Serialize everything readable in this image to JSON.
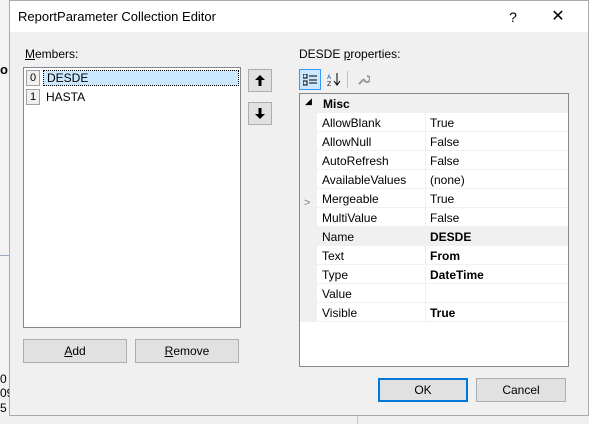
{
  "background": {
    "left_fragments": [
      "0",
      "09",
      "5"
    ],
    "left_bold": "o"
  },
  "dialog": {
    "title": "ReportParameter Collection Editor",
    "help_label": "?",
    "close_label": "✕"
  },
  "members": {
    "label_accel": "M",
    "label_rest": "embers:",
    "items": [
      {
        "index": "0",
        "name": "DESDE",
        "selected": true
      },
      {
        "index": "1",
        "name": "HASTA",
        "selected": false
      }
    ],
    "move_up_icon": "arrow-up-icon",
    "move_down_icon": "arrow-down-icon"
  },
  "buttons": {
    "add_accel": "A",
    "add_rest": "dd",
    "remove_accel": "R",
    "remove_rest": "emove",
    "ok": "OK",
    "cancel": "Cancel"
  },
  "properties": {
    "label_prefix": "DESDE ",
    "label_accel": "p",
    "label_rest": "roperties:",
    "category": "Misc",
    "rows": [
      {
        "name": "AllowBlank",
        "value": "True",
        "bold": false
      },
      {
        "name": "AllowNull",
        "value": "False",
        "bold": false
      },
      {
        "name": "AutoRefresh",
        "value": "False",
        "bold": false
      },
      {
        "name": "AvailableValues",
        "value": "(none)",
        "bold": false,
        "expandable": true
      },
      {
        "name": "Mergeable",
        "value": "True",
        "bold": false
      },
      {
        "name": "MultiValue",
        "value": "False",
        "bold": false
      },
      {
        "name": "Name",
        "value": "DESDE",
        "bold": true
      },
      {
        "name": "Text",
        "value": "From",
        "bold": true
      },
      {
        "name": "Type",
        "value": "DateTime",
        "bold": true
      },
      {
        "name": "Value",
        "value": "",
        "bold": false
      },
      {
        "name": "Visible",
        "value": "True",
        "bold": true
      }
    ]
  }
}
